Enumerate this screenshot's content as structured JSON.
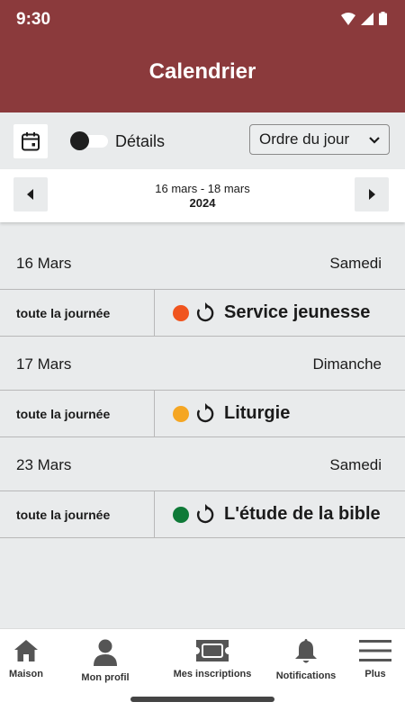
{
  "status_bar": {
    "time": "9:30"
  },
  "header": {
    "title": "Calendrier"
  },
  "toolbar": {
    "details_label": "Détails",
    "details_enabled": false,
    "sort_selected": "Ordre du jour"
  },
  "range": {
    "dates": "16 mars - 18 mars",
    "year": "2024"
  },
  "days": [
    {
      "date": "16 Mars",
      "weekday": "Samedi",
      "event": {
        "time": "toute la journée",
        "title": "Service jeunesse",
        "color": "#f0541e",
        "recurring": true
      }
    },
    {
      "date": "17 Mars",
      "weekday": "Dimanche",
      "event": {
        "time": "toute la journée",
        "title": "Liturgie",
        "color": "#f5a623",
        "recurring": true
      }
    },
    {
      "date": "23 Mars",
      "weekday": "Samedi",
      "event": {
        "time": "toute la journée",
        "title": "L'étude de la bible",
        "color": "#0f7a38",
        "recurring": true
      }
    }
  ],
  "bottom_nav": {
    "home": "Maison",
    "profile": "Mon profil",
    "registrations": "Mes inscriptions",
    "notifications": "Notifications",
    "more": "Plus"
  },
  "colors": {
    "header": "#8b3a3c",
    "background": "#e9ebec"
  }
}
